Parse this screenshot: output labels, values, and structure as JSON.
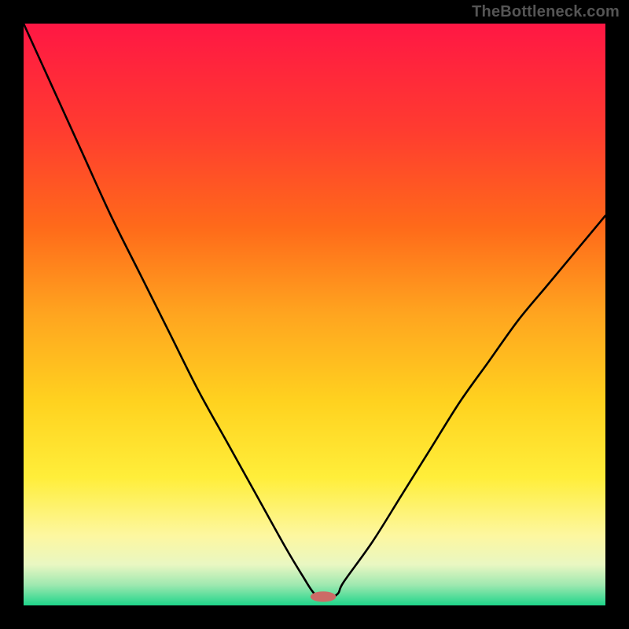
{
  "watermark": "TheBottleneck.com",
  "chart_data": {
    "type": "line",
    "title": "",
    "xlabel": "",
    "ylabel": "",
    "xlim": [
      0,
      100
    ],
    "ylim": [
      0,
      100
    ],
    "grid": false,
    "legend": false,
    "background_gradient": {
      "stops": [
        {
          "offset": 0.0,
          "color": "#ff1744"
        },
        {
          "offset": 0.18,
          "color": "#ff3b30"
        },
        {
          "offset": 0.35,
          "color": "#ff6a1a"
        },
        {
          "offset": 0.5,
          "color": "#ffa51f"
        },
        {
          "offset": 0.65,
          "color": "#ffd21f"
        },
        {
          "offset": 0.78,
          "color": "#ffee3a"
        },
        {
          "offset": 0.88,
          "color": "#fdf7a0"
        },
        {
          "offset": 0.93,
          "color": "#e9f7c2"
        },
        {
          "offset": 0.965,
          "color": "#9ee8b0"
        },
        {
          "offset": 1.0,
          "color": "#1fd58a"
        }
      ]
    },
    "series": [
      {
        "name": "bottleneck-curve",
        "color": "#000000",
        "x": [
          0,
          5,
          10,
          15,
          20,
          25,
          30,
          35,
          40,
          45,
          48,
          50,
          52,
          54,
          55,
          60,
          65,
          70,
          75,
          80,
          85,
          90,
          95,
          100
        ],
        "y": [
          100,
          89,
          78,
          67,
          57,
          47,
          37,
          28,
          19,
          10,
          5,
          2,
          1,
          2,
          4,
          11,
          19,
          27,
          35,
          42,
          49,
          55,
          61,
          67
        ]
      }
    ],
    "marker": {
      "name": "optimal-point",
      "xy_center": [
        51.5,
        1.5
      ],
      "rx_ry_percent": [
        2.2,
        0.9
      ],
      "fill": "#cc6b66"
    }
  }
}
